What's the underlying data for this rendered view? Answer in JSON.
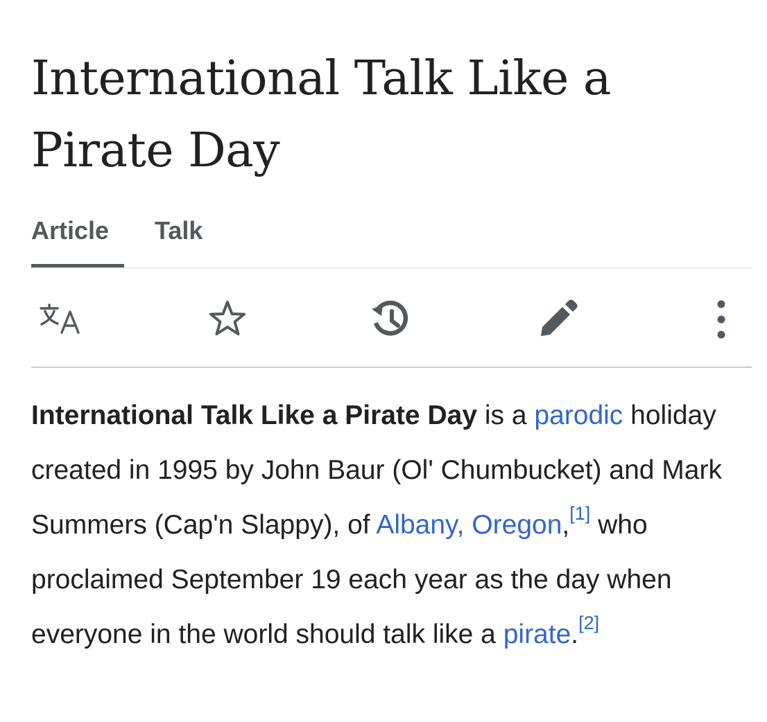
{
  "article": {
    "title_line1": "International Talk Like a",
    "title_line2": "Pirate Day"
  },
  "tabs": [
    {
      "label": "Article",
      "selected": true
    },
    {
      "label": "Talk",
      "selected": false
    }
  ],
  "toolbar": {
    "icons": [
      "language-icon",
      "star-icon",
      "history-icon",
      "edit-pencil-icon",
      "more-menu-icon"
    ]
  },
  "lead": {
    "bold_title": "International Talk Like a Pirate Day",
    "t1": " is a ",
    "link_parodic": "parodic",
    "t2": " holiday created in 1995 by John Baur (Ol' Chumbucket) and Mark Summers (Cap'n Slappy), of ",
    "link_albany": "Albany, Oregon",
    "t3": ",",
    "ref1": "[1]",
    "t4": " who proclaimed September 19 each year as the day when everyone in the world should talk like a ",
    "link_pirate": "pirate",
    "t5": ".",
    "ref2": "[2]"
  },
  "colors": {
    "text": "#202122",
    "link": "#3366cc",
    "tab": "#54595d",
    "icon": "#54595d",
    "divider": "#c8ccd1"
  }
}
